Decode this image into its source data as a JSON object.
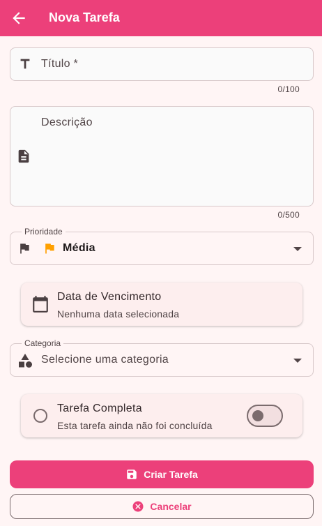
{
  "app_bar": {
    "title": "Nova Tarefa",
    "back_icon": "arrow-back-icon",
    "background": "#ec407a"
  },
  "form": {
    "title_field": {
      "placeholder": "Título *",
      "value": "",
      "counter": "0/100",
      "icon": "text-format-icon"
    },
    "description_field": {
      "placeholder": "Descrição",
      "value": "",
      "counter": "0/500",
      "icon": "document-icon"
    },
    "priority_field": {
      "label": "Prioridade",
      "selected": "Média",
      "flag_color": "#ffa000",
      "icon": "flag-icon"
    },
    "due_date_card": {
      "title": "Data de Vencimento",
      "subtitle": "Nenhuma data selecionada",
      "icon": "calendar-icon"
    },
    "category_field": {
      "label": "Categoria",
      "placeholder": "Selecione uma categoria",
      "icon": "category-shapes-icon"
    },
    "complete_card": {
      "title": "Tarefa Completa",
      "subtitle": "Esta tarefa ainda não foi concluída",
      "checked": false,
      "switch_on": false
    }
  },
  "actions": {
    "create_label": "Criar Tarefa",
    "create_icon": "save-icon",
    "cancel_label": "Cancelar",
    "cancel_icon": "cancel-circle-icon",
    "accent": "#ec407a"
  }
}
